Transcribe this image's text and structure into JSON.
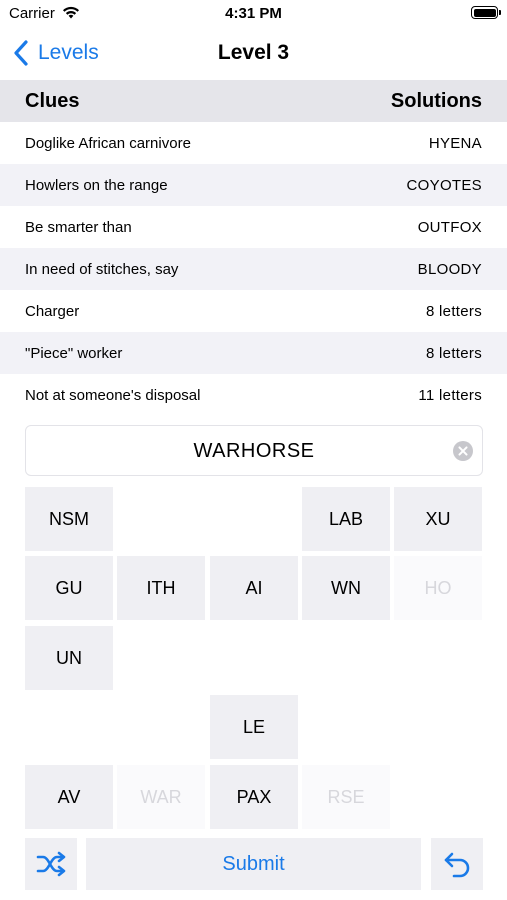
{
  "status": {
    "carrier": "Carrier",
    "time": "4:31 PM"
  },
  "nav": {
    "back_label": "Levels",
    "title": "Level 3"
  },
  "table": {
    "header": {
      "clues": "Clues",
      "solutions": "Solutions"
    },
    "rows": [
      {
        "clue": "Doglike African carnivore",
        "solution": "HYENA"
      },
      {
        "clue": "Howlers on the range",
        "solution": "COYOTES"
      },
      {
        "clue": "Be smarter than",
        "solution": "OUTFOX"
      },
      {
        "clue": "In need of stitches, say",
        "solution": "BLOODY"
      },
      {
        "clue": "Charger",
        "solution": "8 letters"
      },
      {
        "clue": "\"Piece\" worker",
        "solution": "8 letters"
      },
      {
        "clue": "Not at someone's disposal",
        "solution": "11 letters"
      }
    ]
  },
  "answer": {
    "value": "WARHORSE"
  },
  "tiles": [
    {
      "label": "NSM",
      "used": false
    },
    {
      "label": "LAB",
      "used": false
    },
    {
      "label": "XU",
      "used": false
    },
    {
      "label": "GU",
      "used": false
    },
    {
      "label": "ITH",
      "used": false
    },
    {
      "label": "AI",
      "used": false
    },
    {
      "label": "WN",
      "used": false
    },
    {
      "label": "HO",
      "used": true
    },
    {
      "label": "UN",
      "used": false
    },
    {
      "label": "LE",
      "used": false
    },
    {
      "label": "AV",
      "used": false
    },
    {
      "label": "WAR",
      "used": true
    },
    {
      "label": "PAX",
      "used": false
    },
    {
      "label": "RSE",
      "used": true
    }
  ],
  "actions": {
    "submit_label": "Submit"
  },
  "colors": {
    "accent": "#1a7ae8",
    "header_bg": "#e5e5ea",
    "tile_bg": "#efeff3",
    "tile_used_text": "#d7d7dc"
  }
}
